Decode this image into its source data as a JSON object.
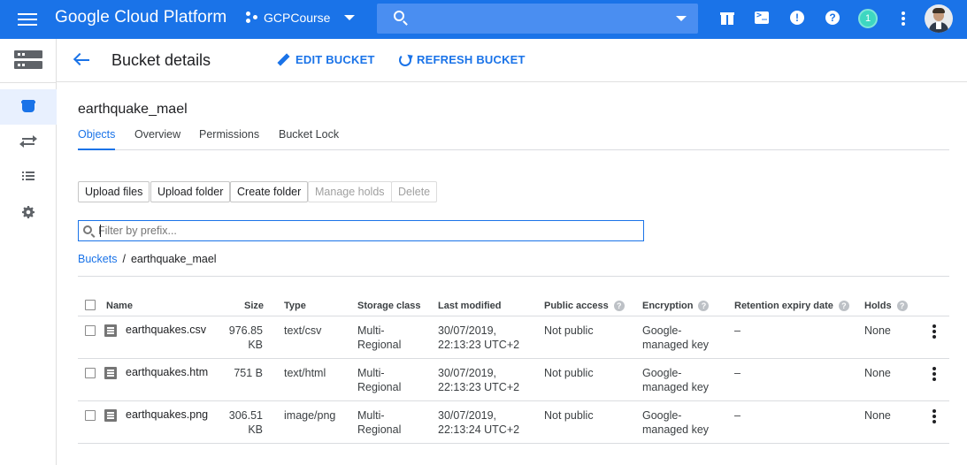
{
  "topbar": {
    "brand": "Google Cloud Platform",
    "project": "GCPCourse",
    "notification_count": "1",
    "brand_color": "#1a73e8"
  },
  "sidenav": {
    "items": [
      {
        "icon": "bucket-icon",
        "active": true
      },
      {
        "icon": "transfer-icon",
        "active": false
      },
      {
        "icon": "list-icon",
        "active": false
      },
      {
        "icon": "gear-icon",
        "active": false
      }
    ]
  },
  "header": {
    "title": "Bucket details",
    "edit_label": "EDIT BUCKET",
    "refresh_label": "REFRESH BUCKET"
  },
  "bucket": {
    "name": "earthquake_mael"
  },
  "tabs": [
    {
      "label": "Objects",
      "active": true
    },
    {
      "label": "Overview",
      "active": false
    },
    {
      "label": "Permissions",
      "active": false
    },
    {
      "label": "Bucket Lock",
      "active": false
    }
  ],
  "toolbar": {
    "upload_files": "Upload files",
    "upload_folder": "Upload folder",
    "create_folder": "Create folder",
    "manage_holds": "Manage holds",
    "delete": "Delete"
  },
  "filter": {
    "placeholder": "Filter by prefix..."
  },
  "breadcrumb": {
    "root": "Buckets",
    "separator": "/",
    "current": "earthquake_mael"
  },
  "table": {
    "columns": {
      "name": "Name",
      "size": "Size",
      "type": "Type",
      "storage_class": "Storage class",
      "last_modified": "Last modified",
      "public_access": "Public access",
      "encryption": "Encryption",
      "retention": "Retention expiry date",
      "holds": "Holds"
    },
    "rows": [
      {
        "name": "earthquakes.csv",
        "size_1": "976.85",
        "size_2": "KB",
        "type": "text/csv",
        "storage_1": "Multi-",
        "storage_2": "Regional",
        "modified_1": "30/07/2019,",
        "modified_2": "22:13:23 UTC+2",
        "public_access": "Not public",
        "encryption_1": "Google-",
        "encryption_2": "managed key",
        "retention": "–",
        "holds": "None"
      },
      {
        "name": "earthquakes.htm",
        "size_1": "751 B",
        "size_2": "",
        "type": "text/html",
        "storage_1": "Multi-",
        "storage_2": "Regional",
        "modified_1": "30/07/2019,",
        "modified_2": "22:13:23 UTC+2",
        "public_access": "Not public",
        "encryption_1": "Google-",
        "encryption_2": "managed key",
        "retention": "–",
        "holds": "None"
      },
      {
        "name": "earthquakes.png",
        "size_1": "306.51",
        "size_2": "KB",
        "type": "image/png",
        "storage_1": "Multi-",
        "storage_2": "Regional",
        "modified_1": "30/07/2019,",
        "modified_2": "22:13:24 UTC+2",
        "public_access": "Not public",
        "encryption_1": "Google-",
        "encryption_2": "managed key",
        "retention": "–",
        "holds": "None"
      }
    ]
  }
}
